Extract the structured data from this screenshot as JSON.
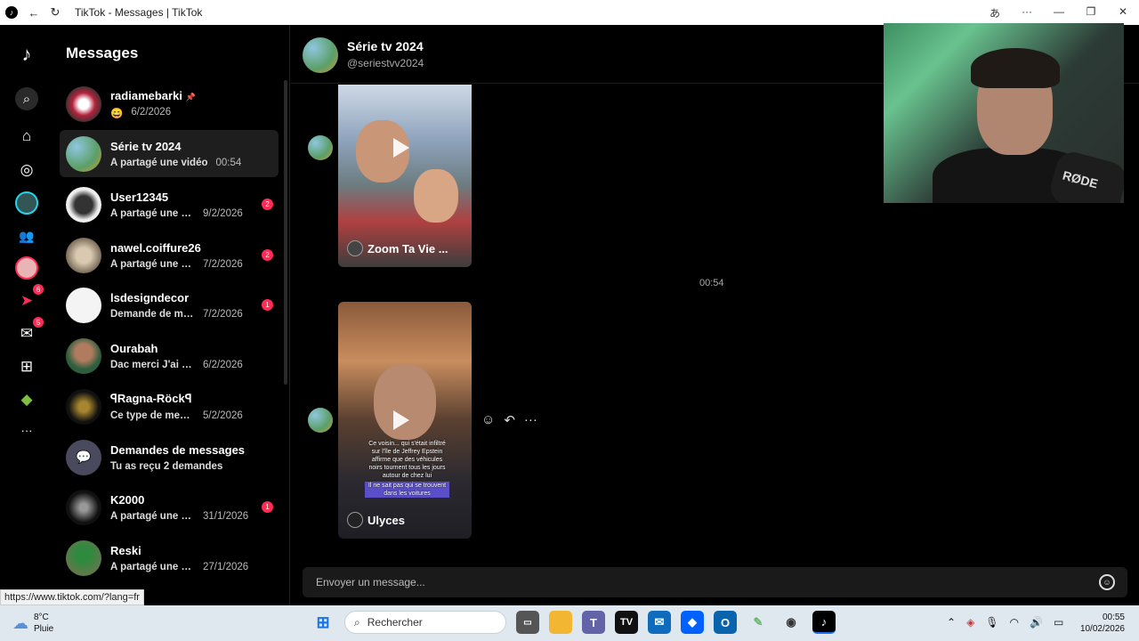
{
  "window": {
    "title": "TikTok - Messages | TikTok",
    "app_logo": "♪",
    "translate_icon": "あ",
    "more_icon": "···",
    "minimize": "—",
    "maximize": "❐",
    "close": "✕"
  },
  "rail": {
    "items": [
      {
        "name": "tiktok-logo-icon",
        "glyph": "♪"
      },
      {
        "name": "search-icon",
        "glyph": "⌕"
      },
      {
        "name": "home-icon",
        "glyph": "⌂"
      },
      {
        "name": "explore-icon",
        "glyph": "◎"
      },
      {
        "name": "live-icon",
        "glyph": "●"
      },
      {
        "name": "following-icon",
        "glyph": "👥"
      },
      {
        "name": "profile-icon",
        "glyph": "●"
      },
      {
        "name": "activity-icon",
        "glyph": "➤",
        "badge": "6"
      },
      {
        "name": "messages-icon",
        "glyph": "✉",
        "badge": "5"
      },
      {
        "name": "upload-icon",
        "glyph": "⊞"
      },
      {
        "name": "game-icon",
        "glyph": "◆"
      },
      {
        "name": "more-icon",
        "glyph": "···"
      }
    ]
  },
  "conversations": {
    "heading": "Messages",
    "items": [
      {
        "name": "radiamebarki",
        "pin": "📌",
        "preview": "😄",
        "date": "6/2/2026",
        "unread": "",
        "avatar_color": "#b4223a"
      },
      {
        "name": "Série tv 2024",
        "preview": "A partagé une vidéo",
        "date": "00:54",
        "unread": "",
        "avatar_color": "#6aa9b8"
      },
      {
        "name": "User12345",
        "preview": "A partagé une vi...",
        "date": "9/2/2026",
        "unread": "2",
        "avatar_color": "#ddd"
      },
      {
        "name": "nawel.coiffure26",
        "preview": "A partagé une vid...",
        "date": "7/2/2026",
        "unread": "2",
        "avatar_color": "#8a7e6c"
      },
      {
        "name": "lsdesigndecor",
        "preview": "Demande de mes...",
        "date": "7/2/2026",
        "unread": "1",
        "avatar_color": "#f4f4f4"
      },
      {
        "name": "Ourabah",
        "preview": "Dac merci J'ai un...",
        "date": "6/2/2026",
        "unread": "",
        "avatar_color": "#2d5e3d"
      },
      {
        "name": "ꟼRagna-Röckꟼ",
        "preview": "Ce type de mess...",
        "date": "5/2/2026",
        "unread": "",
        "avatar_color": "#1a1a1a"
      },
      {
        "name": "Demandes de messages",
        "preview": "Tu as reçu 2 demandes",
        "date": "",
        "unread": "",
        "avatar_color": "#4a4a5e"
      },
      {
        "name": "K2000",
        "preview": "A partagé une vi...",
        "date": "31/1/2026",
        "unread": "1",
        "avatar_color": "#222"
      },
      {
        "name": "Reski",
        "preview": "A partagé une vi...",
        "date": "27/1/2026",
        "unread": "",
        "avatar_color": "#5b7a4a"
      }
    ]
  },
  "chat": {
    "name": "Série tv 2024",
    "handle": "@seriestvv2024",
    "timestamp": "00:54",
    "videos": [
      {
        "label": "Zoom Ta Vie ..."
      },
      {
        "label": "Ulyces",
        "overlay": "Ce voisin... qui s'était infiltré sur l'île de Jeffrey Epstein affirme que des véhicules noirs tournent tous les jours autour de chez lui",
        "overlay_highlight": "Il ne sait pas qui se trouvent dans les voitures"
      }
    ],
    "composer_placeholder": "Envoyer un message..."
  },
  "status_url": "https://www.tiktok.com/?lang=fr",
  "taskbar": {
    "temp": "8°C",
    "weather": "Pluie",
    "search": "Rechercher",
    "time": "00:55",
    "date": "10/02/2026"
  },
  "webcam": {
    "mic_text": "RØDE"
  }
}
